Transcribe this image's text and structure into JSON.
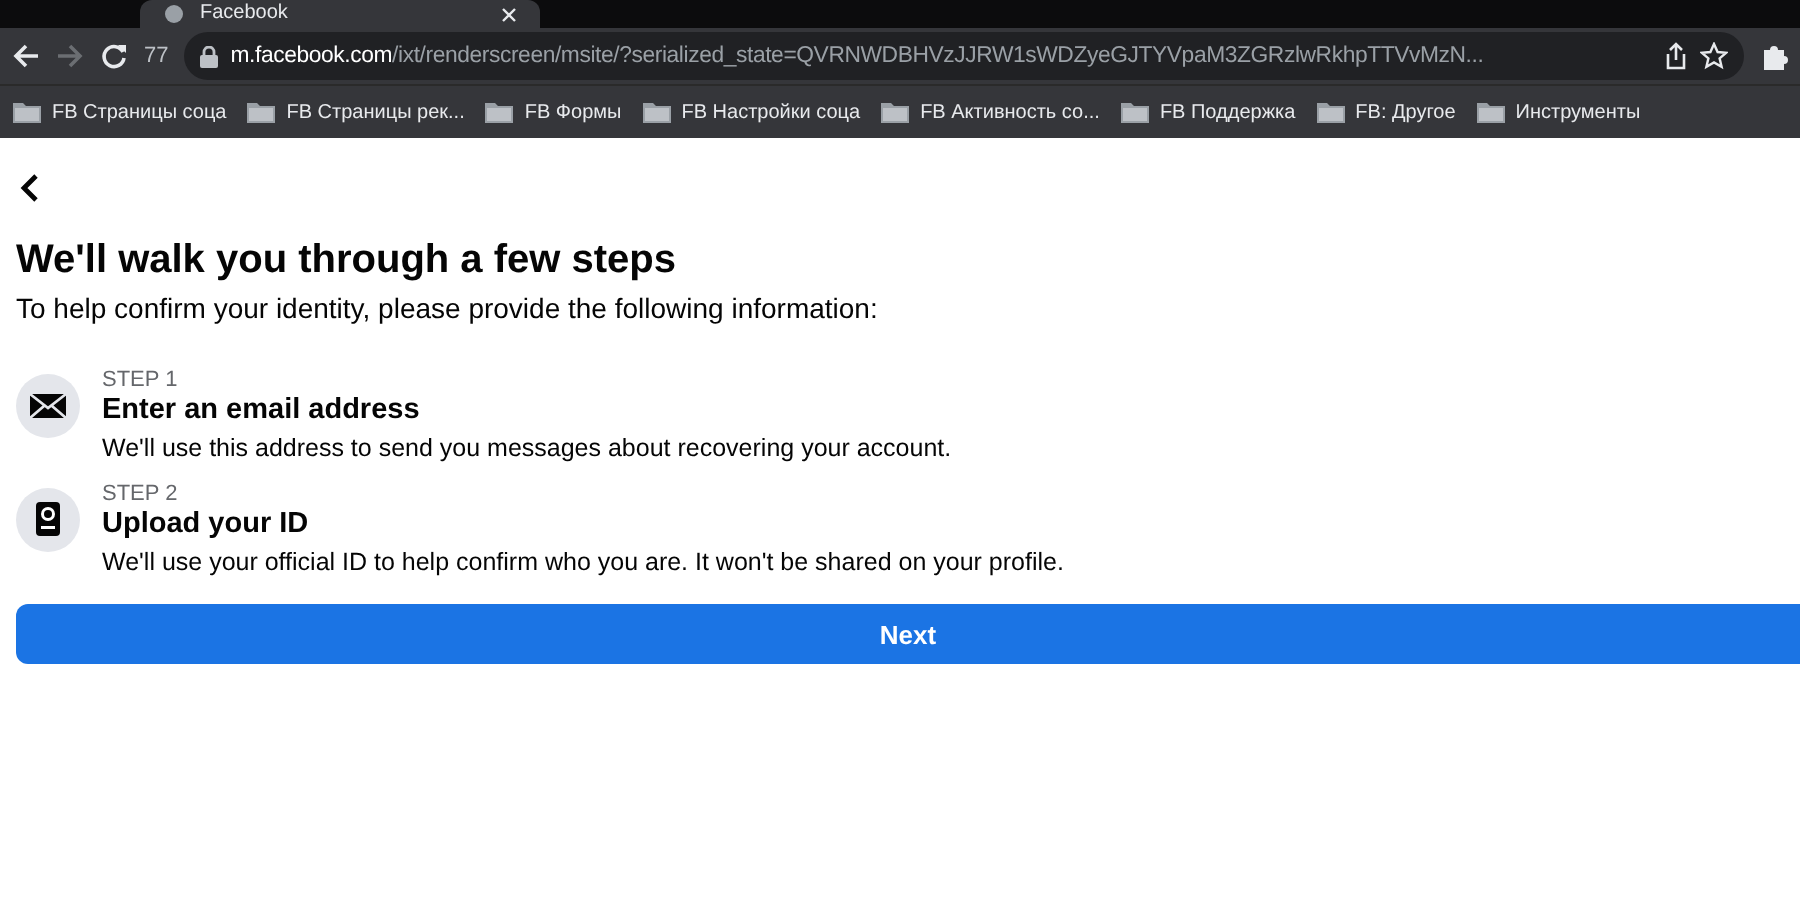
{
  "browser": {
    "tab_title": "Facebook",
    "reload_badge": "77",
    "url_host": "m.facebook.com",
    "url_path": "/ixt/renderscreen/msite/?serialized_state=QVRNWDBHVzJJRW1sWDZyeGJTYVpaM3ZGRzlwRkhpTTVvMzN...",
    "bookmarks": [
      "FB Страницы соца",
      "FB Страницы рек...",
      "FB Формы",
      "FB Настройки соца",
      "FB Активность со...",
      "FB Поддержка",
      "FB: Другое",
      "Инструменты"
    ]
  },
  "page": {
    "title": "We'll walk you through a few steps",
    "subtitle": "To help confirm your identity, please provide the following information:",
    "steps": [
      {
        "kind": "email",
        "step": "STEP 1",
        "title": "Enter an email address",
        "description": "We'll use this address to send you messages about recovering your account."
      },
      {
        "kind": "id",
        "step": "STEP 2",
        "title": "Upload your ID",
        "description": "We'll use your official ID to help confirm who you are. It won't be shared on your profile."
      }
    ],
    "button": "Next"
  }
}
